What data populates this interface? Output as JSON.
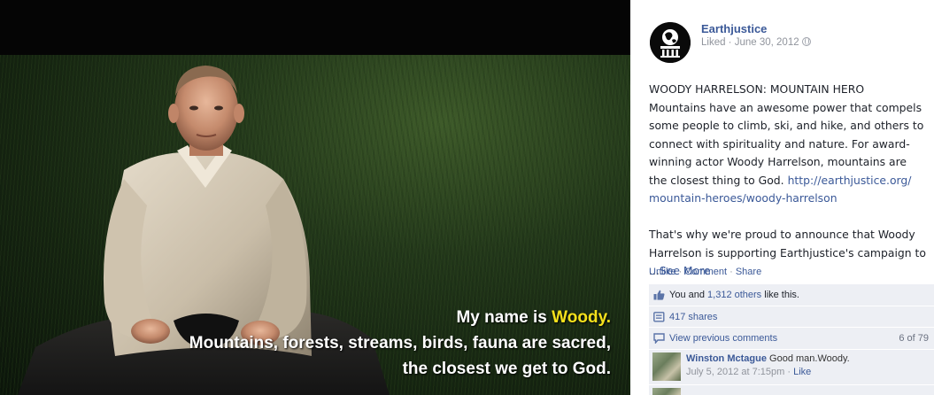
{
  "photo": {
    "caption_prefix": "My name is ",
    "caption_highlight": "Woody.",
    "caption_line2": "Mountains, forests, streams, birds, fauna are sacred,",
    "caption_line3": "the closest we get to God.",
    "highlight_color": "#f5e11c"
  },
  "post": {
    "page_name": "Earthjustice",
    "meta": "Liked · June 30, 2012",
    "privacy_icon": "globe-icon",
    "text_lines": [
      "WOODY HARRELSON: MOUNTAIN HERO",
      "Mountains have an awesome power that compels",
      "some people to climb, ski, and hike, and others to",
      "connect with spirituality and nature. For award-",
      "winning actor Woody Harrelson, mountains are"
    ],
    "line6_text": "the closest thing to God. ",
    "line6_link": "http://earthjustice.org/",
    "line7_link": "mountain-heroes/woody-harrelson",
    "para2_lines": [
      "That's why we're proud to announce that Woody",
      "Harrelson is supporting Earthjustice's campaign to"
    ],
    "see_more_prefix": "...",
    "see_more": "See More",
    "actions": {
      "unlike": "Unlike",
      "comment": "Comment",
      "share": "Share",
      "separator": " · "
    }
  },
  "ufi": {
    "likes_prefix": "You and ",
    "likes_link": "1,312 others",
    "likes_suffix": " like this.",
    "shares": "417 shares",
    "view_previous": "View previous comments",
    "comment_count": "6 of 79",
    "comments": [
      {
        "author": "Winston Mctague",
        "text": " Good man.Woody.",
        "time": "July 5, 2012 at 7:15pm",
        "sep": " · ",
        "like": "Like"
      }
    ]
  },
  "colors": {
    "brand_blue": "#3b5998",
    "ufi_bg": "#edeff4"
  }
}
